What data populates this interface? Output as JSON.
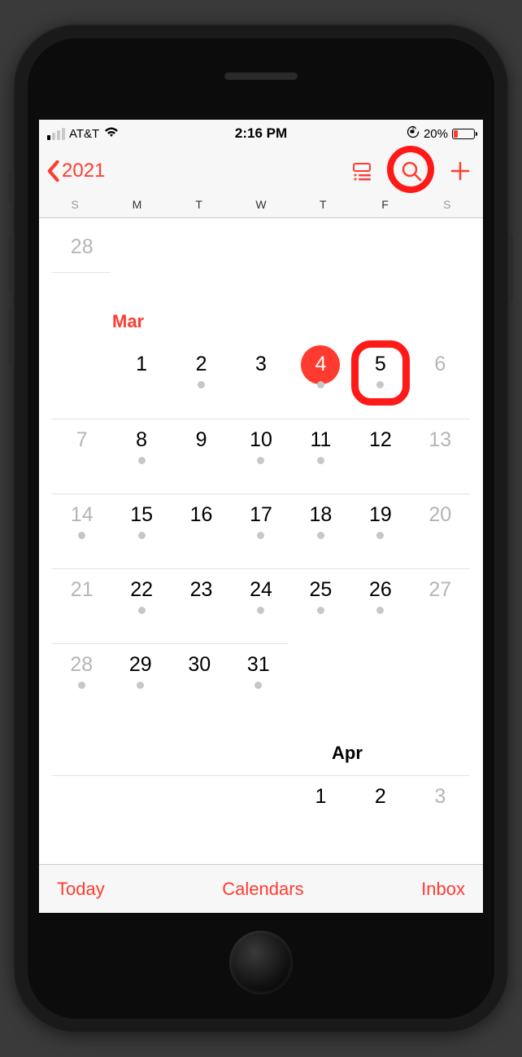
{
  "status": {
    "carrier": "AT&T",
    "time": "2:16 PM",
    "battery_pct": "20%"
  },
  "nav": {
    "back_label": "2021"
  },
  "dow": [
    "S",
    "M",
    "T",
    "W",
    "T",
    "F",
    "S"
  ],
  "tail_day": "28",
  "month1": {
    "label": "Mar",
    "weeks": [
      [
        {
          "n": "",
          "dot": false,
          "weekend": true
        },
        {
          "n": "1",
          "dot": false
        },
        {
          "n": "2",
          "dot": true
        },
        {
          "n": "3",
          "dot": false
        },
        {
          "n": "4",
          "dot": true,
          "today": true
        },
        {
          "n": "5",
          "dot": true,
          "highlight": true
        },
        {
          "n": "6",
          "dot": false,
          "weekend": true
        }
      ],
      [
        {
          "n": "7",
          "dot": false,
          "weekend": true
        },
        {
          "n": "8",
          "dot": true
        },
        {
          "n": "9",
          "dot": false
        },
        {
          "n": "10",
          "dot": true
        },
        {
          "n": "11",
          "dot": true
        },
        {
          "n": "12",
          "dot": false
        },
        {
          "n": "13",
          "dot": false,
          "weekend": true
        }
      ],
      [
        {
          "n": "14",
          "dot": true,
          "weekend": true
        },
        {
          "n": "15",
          "dot": true
        },
        {
          "n": "16",
          "dot": false
        },
        {
          "n": "17",
          "dot": true
        },
        {
          "n": "18",
          "dot": true
        },
        {
          "n": "19",
          "dot": true
        },
        {
          "n": "20",
          "dot": false,
          "weekend": true
        }
      ],
      [
        {
          "n": "21",
          "dot": false,
          "weekend": true
        },
        {
          "n": "22",
          "dot": true
        },
        {
          "n": "23",
          "dot": false
        },
        {
          "n": "24",
          "dot": true
        },
        {
          "n": "25",
          "dot": true
        },
        {
          "n": "26",
          "dot": true
        },
        {
          "n": "27",
          "dot": false,
          "weekend": true
        }
      ],
      [
        {
          "n": "28",
          "dot": true,
          "weekend": true
        },
        {
          "n": "29",
          "dot": true
        },
        {
          "n": "30",
          "dot": false
        },
        {
          "n": "31",
          "dot": true
        },
        {
          "n": "",
          "dot": false
        },
        {
          "n": "",
          "dot": false
        },
        {
          "n": "",
          "dot": false
        }
      ]
    ]
  },
  "month2": {
    "label": "Apr",
    "row": [
      {
        "n": ""
      },
      {
        "n": ""
      },
      {
        "n": ""
      },
      {
        "n": ""
      },
      {
        "n": "1"
      },
      {
        "n": "2"
      },
      {
        "n": "3",
        "weekend": true
      }
    ]
  },
  "toolbar": {
    "today": "Today",
    "calendars": "Calendars",
    "inbox": "Inbox"
  }
}
